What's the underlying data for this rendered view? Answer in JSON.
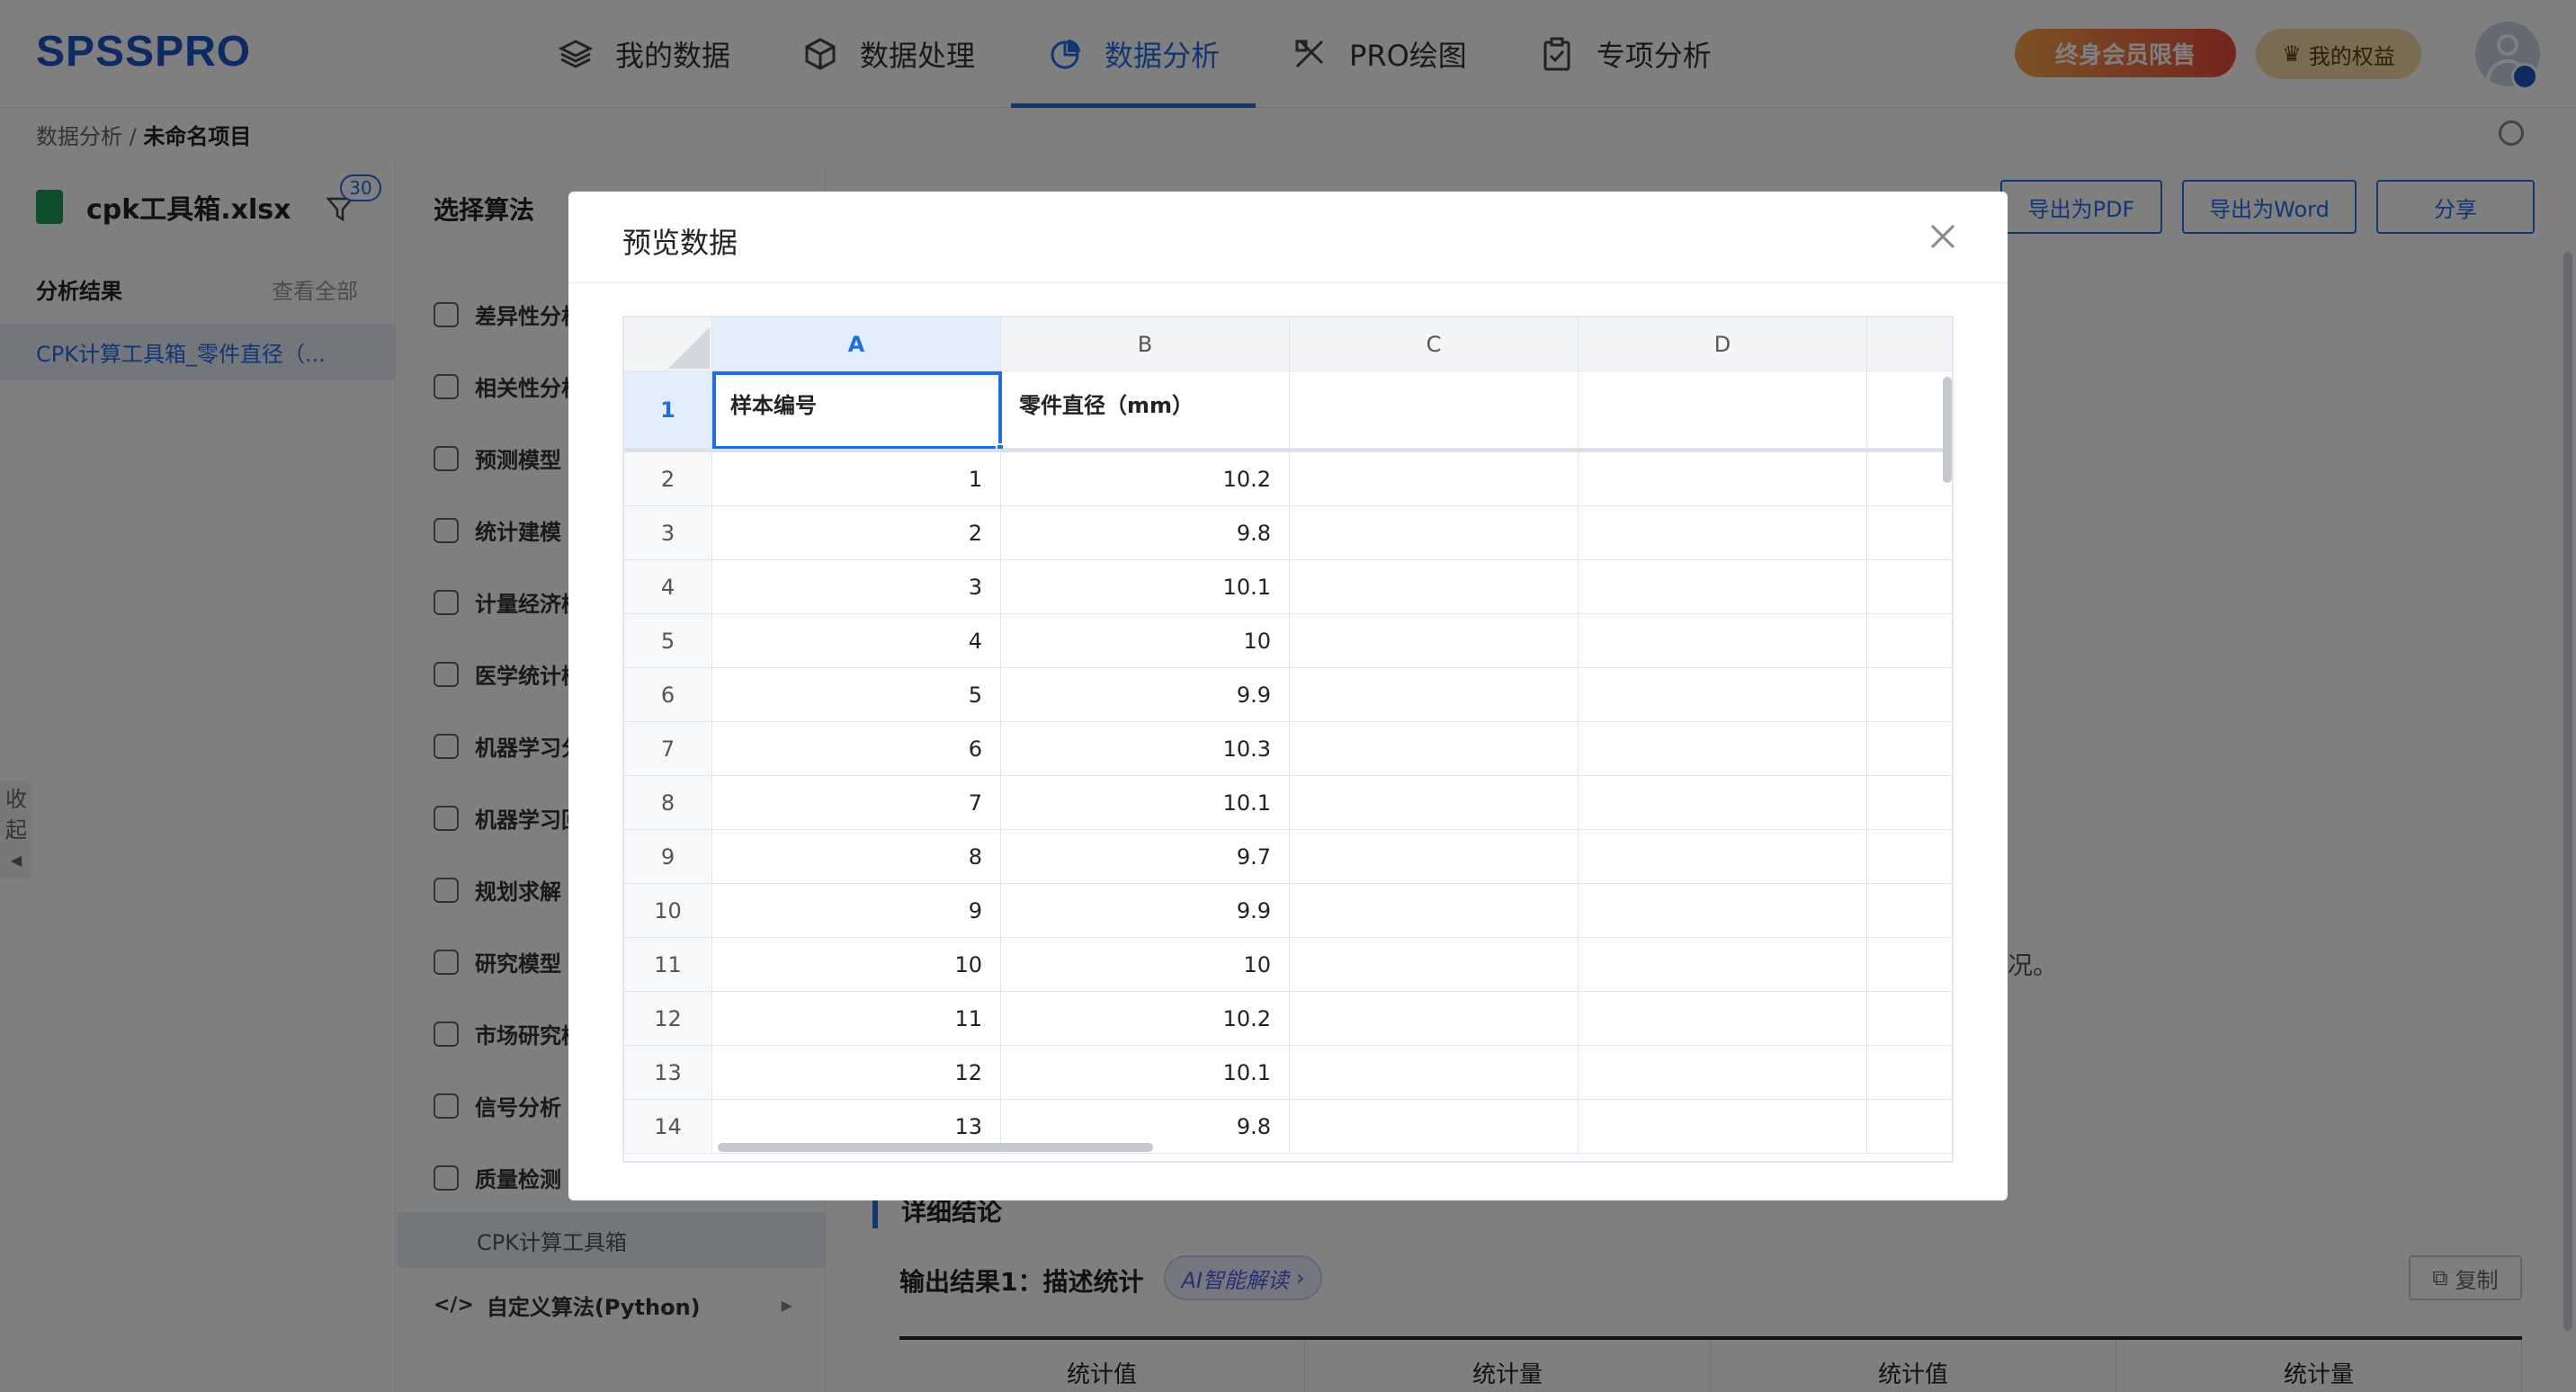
{
  "app": {
    "logo": "SPSSPRO"
  },
  "nav": {
    "items": [
      {
        "label": "我的数据",
        "icon": "layers-icon"
      },
      {
        "label": "数据处理",
        "icon": "cube-icon"
      },
      {
        "label": "数据分析",
        "icon": "pie-chart-icon",
        "active": true
      },
      {
        "label": "PRO绘图",
        "icon": "draw-tools-icon"
      },
      {
        "label": "专项分析",
        "icon": "clipboard-icon"
      }
    ],
    "promo_label": "终身会员限售",
    "rights_label": "我的权益"
  },
  "breadcrumb": {
    "root": "数据分析",
    "separator": "/",
    "current": "未命名项目"
  },
  "sidebar": {
    "file_name": "cpk工具箱.xlsx",
    "filter_badge": "30",
    "results_heading": "分析结果",
    "view_all": "查看全部",
    "result_item": "CPK计算工具箱_零件直径（...",
    "collapse_label": [
      "收",
      "起"
    ]
  },
  "algorithms": {
    "title": "选择算法",
    "items": [
      {
        "label": "差异性分析",
        "icon": "diff-chart-icon"
      },
      {
        "label": "相关性分析",
        "icon": "copy-squares-icon"
      },
      {
        "label": "预测模型",
        "icon": "trend-node-icon"
      },
      {
        "label": "统计建模",
        "icon": "cluster-icon"
      },
      {
        "label": "计量经济模型",
        "icon": "columns-icon"
      },
      {
        "label": "医学统计模型",
        "icon": "stethoscope-icon"
      },
      {
        "label": "机器学习分类",
        "icon": "percent-icon"
      },
      {
        "label": "机器学习回归",
        "icon": "line-chart-icon"
      },
      {
        "label": "规划求解",
        "icon": "route-icon"
      },
      {
        "label": "研究模型",
        "icon": "monitor-chart-icon"
      },
      {
        "label": "市场研究模型",
        "icon": "yen-icon"
      },
      {
        "label": "信号分析",
        "icon": "signal-icon"
      },
      {
        "label": "质量检测",
        "icon": "scan-icon"
      }
    ],
    "sub_item": "CPK计算工具箱",
    "custom_item": "自定义算法(Python)"
  },
  "main": {
    "export_pdf": "导出为PDF",
    "export_word": "导出为Word",
    "share": "分享",
    "snippet": "况。",
    "section_title": "详细结论",
    "output_title": "输出结果1：描述统计",
    "ai_chip": "AI智能解读",
    "copy_label": "复制",
    "stat_headers": [
      "统计值",
      "统计量",
      "统计值",
      "统计量"
    ]
  },
  "modal": {
    "title": "预览数据",
    "columns": [
      "A",
      "B",
      "C",
      "D"
    ],
    "header_row": {
      "row": "1",
      "cells": [
        "样本编号",
        "零件直径（mm）",
        "",
        ""
      ]
    },
    "rows": [
      {
        "row": "2",
        "cells": [
          "1",
          "10.2",
          "",
          ""
        ]
      },
      {
        "row": "3",
        "cells": [
          "2",
          "9.8",
          "",
          ""
        ]
      },
      {
        "row": "4",
        "cells": [
          "3",
          "10.1",
          "",
          ""
        ]
      },
      {
        "row": "5",
        "cells": [
          "4",
          "10",
          "",
          ""
        ]
      },
      {
        "row": "6",
        "cells": [
          "5",
          "9.9",
          "",
          ""
        ]
      },
      {
        "row": "7",
        "cells": [
          "6",
          "10.3",
          "",
          ""
        ]
      },
      {
        "row": "8",
        "cells": [
          "7",
          "10.1",
          "",
          ""
        ]
      },
      {
        "row": "9",
        "cells": [
          "8",
          "9.7",
          "",
          ""
        ]
      },
      {
        "row": "10",
        "cells": [
          "9",
          "9.9",
          "",
          ""
        ]
      },
      {
        "row": "11",
        "cells": [
          "10",
          "10",
          "",
          ""
        ]
      },
      {
        "row": "12",
        "cells": [
          "11",
          "10.2",
          "",
          ""
        ]
      },
      {
        "row": "13",
        "cells": [
          "12",
          "10.1",
          "",
          ""
        ]
      },
      {
        "row": "14",
        "cells": [
          "13",
          "9.8",
          "",
          ""
        ]
      }
    ]
  }
}
